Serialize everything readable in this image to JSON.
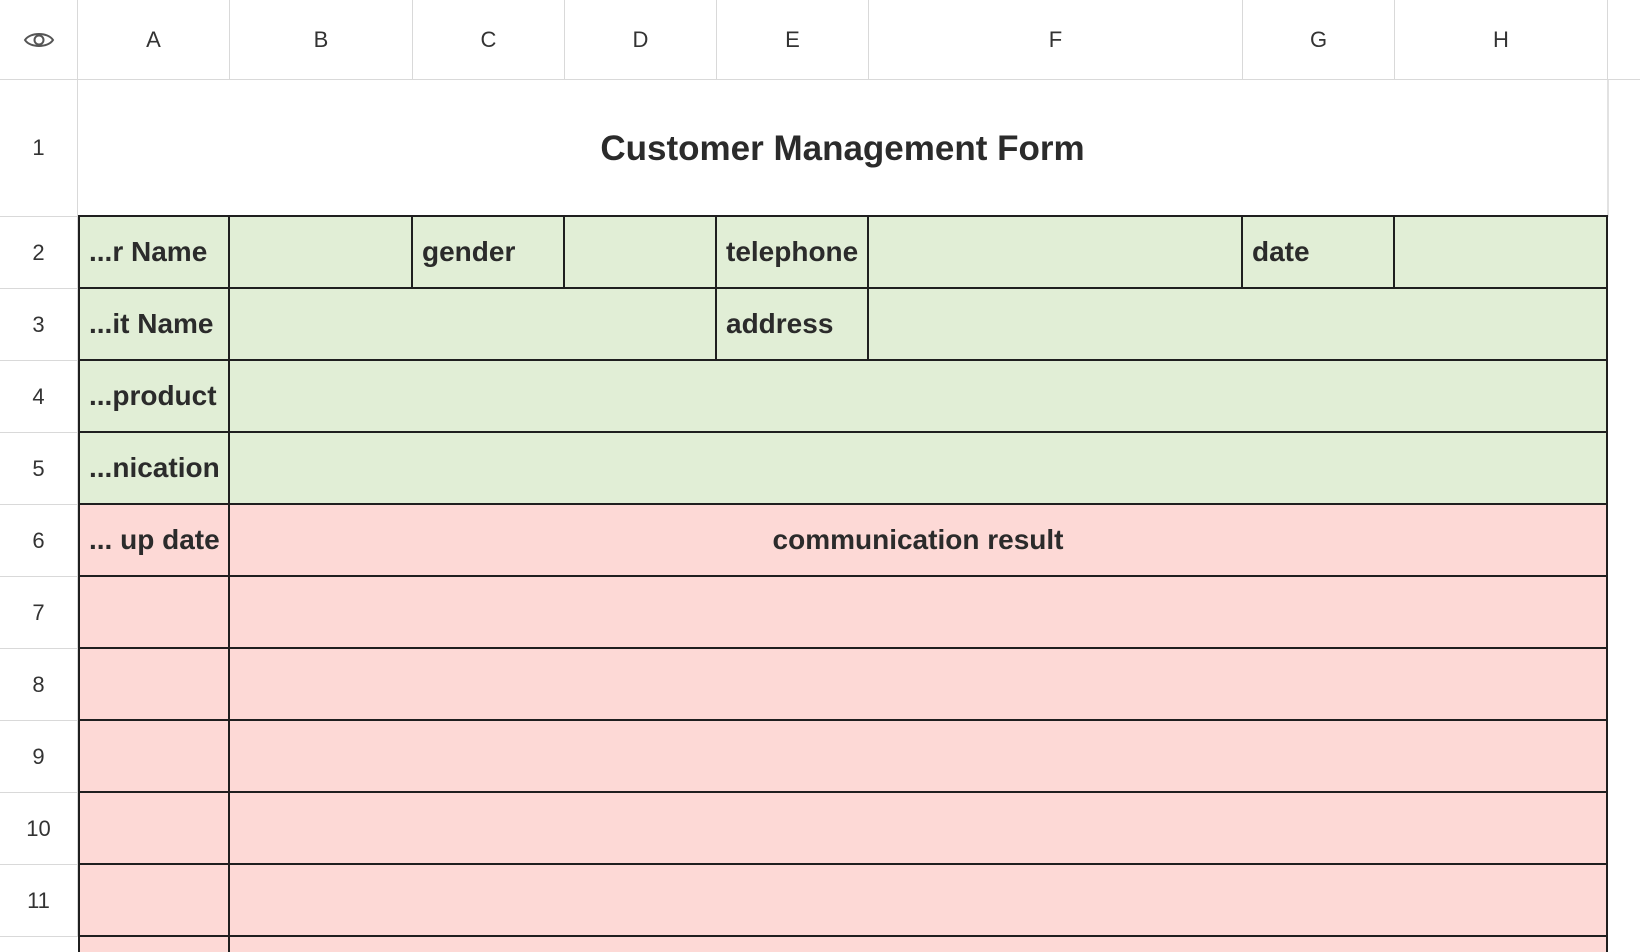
{
  "columns": [
    "A",
    "B",
    "C",
    "D",
    "E",
    "F",
    "G",
    "H"
  ],
  "rows": [
    "1",
    "2",
    "3",
    "4",
    "5",
    "6",
    "7",
    "8",
    "9",
    "10",
    "11"
  ],
  "icons": {
    "corner": "eye-icon"
  },
  "colors": {
    "green_fill": "#e1eed6",
    "pink_fill": "#fdd9d6",
    "border": "#1f1f1f"
  },
  "form": {
    "title": "Customer Management Form",
    "row2": {
      "name_label": "...r Name",
      "gender_label": "gender",
      "telephone_label": "telephone",
      "date_label": "date"
    },
    "row3": {
      "unit_label": "...it Name",
      "address_label": "address"
    },
    "row4": {
      "product_label": "...product"
    },
    "row5": {
      "communication_label": "...nication"
    },
    "row6": {
      "followup_label": "... up date",
      "result_label": "communication result"
    }
  }
}
